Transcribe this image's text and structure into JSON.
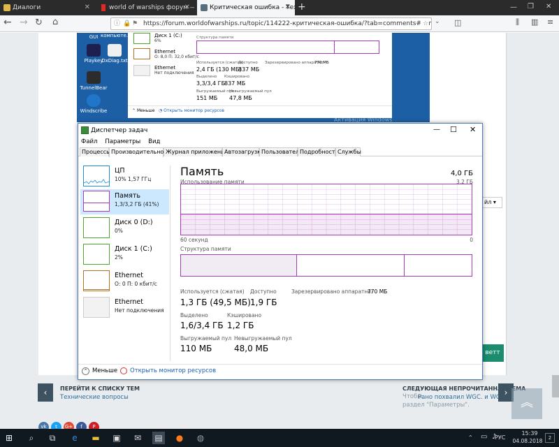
{
  "browser": {
    "tabs": [
      {
        "label": "Диалоги",
        "color": "#e0b94a"
      },
      {
        "label": "world of warships форум — Ян",
        "color": "#e02a1f"
      },
      {
        "label": "Критическая ошибка - Техн",
        "color": "#5a6f7e"
      }
    ],
    "url": "https://forum.worldofwarships.ru/topic/114222-критическая-ошибка/?tab=comments#comm"
  },
  "bg_shot": {
    "desktop_icons": [
      "Playkey",
      "DxDiag.txt",
      "TunnelBear",
      "Windscribe"
    ],
    "desktop_icon_top": "компьюте...",
    "desktop_icon_gui": "GUI",
    "disk_name": "Диск 1 (C:)",
    "disk_val": "6%",
    "eth1_name": "Ethernet",
    "eth1_val": "О: 8,0 П: 32,0 кбит/с",
    "eth2_name": "Ethernet",
    "eth2_val": "Нет подключения",
    "struct_label": "Структура памяти",
    "used_label": "Используется (сжатая)",
    "used_val": "2,4 ГБ (130 МБ)",
    "avail_label": "Доступно",
    "avail_val": "837 МБ",
    "res_label": "Зарезервировано аппаратно:",
    "res_val": "770 МБ",
    "alloc_label": "Выделено",
    "alloc_val": "3,3/3,4 ГБ",
    "cache_label": "Кэшировано",
    "cache_val": "837 МБ",
    "paged_label": "Выгружаемый пул",
    "paged_val": "151 МБ",
    "nonpaged_label": "Невыгружаемый пул",
    "nonpaged_val": "47,8 МБ",
    "less": "Меньше",
    "monitor": "Открыть монитор ресурсов",
    "activation": "Активация Windows"
  },
  "taskmanager": {
    "title": "Диспетчер задач",
    "menu": [
      "Файл",
      "Параметры",
      "Вид"
    ],
    "tabs": [
      "Процессы",
      "Производительность",
      "Журнал приложений",
      "Автозагрузка",
      "Пользователи",
      "Подробности",
      "Службы"
    ],
    "sidebar": [
      {
        "name": "ЦП",
        "sub": "10% 1,57 ГГц",
        "color": "#1a8fd6"
      },
      {
        "name": "Память",
        "sub": "1,3/3,2 ГБ (41%)",
        "color": "#a43ab7"
      },
      {
        "name": "Диск 0 (D:)",
        "sub": "0%",
        "color": "#4aa626"
      },
      {
        "name": "Диск 1 (C:)",
        "sub": "2%",
        "color": "#4aa626"
      },
      {
        "name": "Ethernet",
        "sub": "О: 0 П: 0 кбит/с",
        "color": "#b86e1d"
      },
      {
        "name": "Ethernet",
        "sub": "Нет подключения",
        "color": "#999999"
      }
    ],
    "selected_index": 1,
    "main": {
      "heading": "Память",
      "total": "4,0 ГБ",
      "usage_label": "Использование памяти",
      "usage_max": "3,2 ГБ",
      "time_label": "60 секунд",
      "time_zero": "0",
      "usage_fraction": 0.41,
      "struct_label": "Структура памяти",
      "struct_used_fraction": 0.4,
      "struct_modified_fraction": 0.37,
      "stats": {
        "used_label": "Используется (сжатая)",
        "used_val": "1,3 ГБ (49,5 МБ)",
        "avail_label": "Доступно",
        "avail_val": "1,9 ГБ",
        "res_label": "Зарезервировано аппаратно:",
        "res_val": "770 МБ",
        "alloc_label": "Выделено",
        "alloc_val": "1,6/3,4 ГБ",
        "cache_label": "Кэшировано",
        "cache_val": "1,2 ГБ",
        "paged_label": "Выгружаемый пул",
        "paged_val": "110 МБ",
        "nonpaged_label": "Невыгружаемый пул",
        "nonpaged_val": "48,0 МБ"
      }
    },
    "footer": {
      "less": "Меньше",
      "monitor": "Открыть монитор ресурсов"
    },
    "accent": "#a43ab7"
  },
  "forum": {
    "back_label": "ПЕРЕЙТИ К СПИСКУ ТЕМ",
    "back_sub": "Технические вопросы",
    "next_label": "СЛЕДУЮЩАЯ НЕПРОЧИТАННАЯ ТЕМА",
    "next_sub": "Рано похвалил WGC. и WG..",
    "peek1": "Чтобы",
    "peek2": "раздел \"Параметры\".",
    "dropdown": "йл",
    "answer": "ветт",
    "social": [
      {
        "label": "vk",
        "color": "#4a76a8"
      },
      {
        "label": "t",
        "color": "#1da1f2"
      },
      {
        "label": "G+",
        "color": "#dd4b39"
      },
      {
        "label": "f",
        "color": "#3b5998"
      },
      {
        "label": "P",
        "color": "#cb2027"
      }
    ]
  },
  "taskbar": {
    "lang": "РУС",
    "time": "15:39",
    "date": "04.08.2018",
    "badge": "2"
  }
}
